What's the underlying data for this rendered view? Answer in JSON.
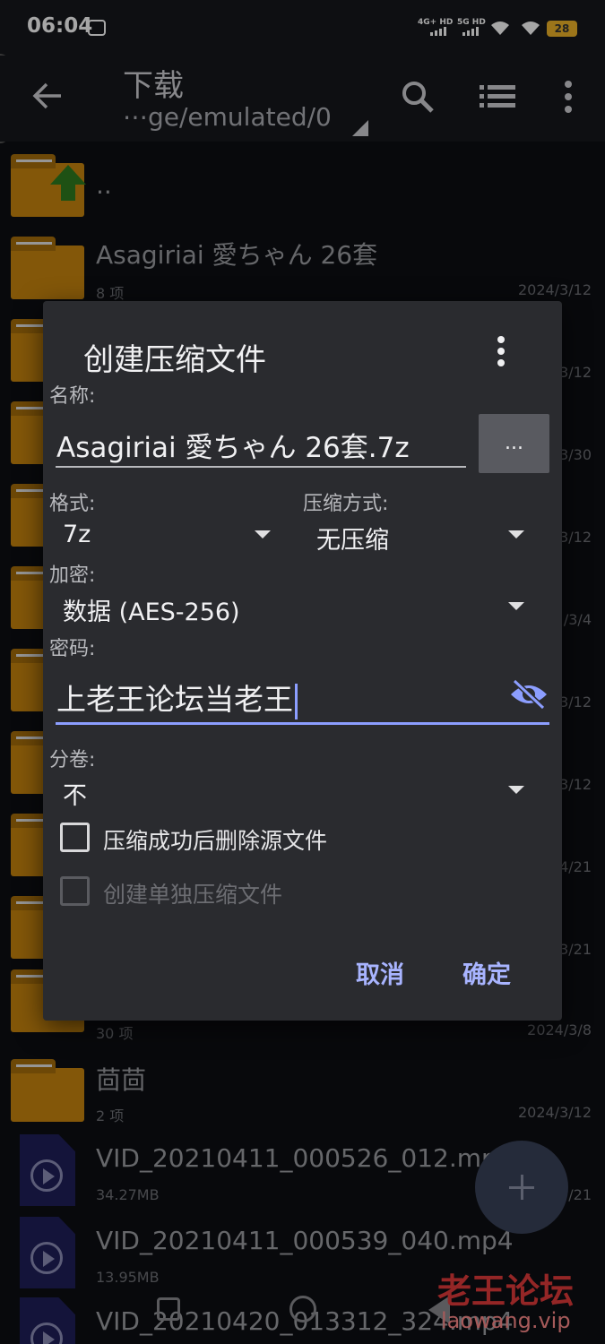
{
  "status": {
    "time": "06:04",
    "sim1": "4G+ HD",
    "sim2": "5G HD",
    "battery": "28"
  },
  "appbar": {
    "title": "下载",
    "path": "⋯ge/emulated/0"
  },
  "files": [
    {
      "name": "..",
      "sub": "",
      "date": "",
      "kind": "up"
    },
    {
      "name": "Asagiriai 愛ちゃん  26套",
      "sub": "8 项",
      "date": "2024/3/12",
      "kind": "folder"
    },
    {
      "name": "",
      "sub": "",
      "date": "3/12",
      "kind": "folder"
    },
    {
      "name": "",
      "sub": "",
      "date": "3/30",
      "kind": "folder"
    },
    {
      "name": "",
      "sub": "",
      "date": "3/12",
      "kind": "folder"
    },
    {
      "name": "",
      "sub": "",
      "date": "/3/4",
      "kind": "folder"
    },
    {
      "name": "",
      "sub": "",
      "date": "3/12",
      "kind": "folder"
    },
    {
      "name": "",
      "sub": "",
      "date": "3/12",
      "kind": "folder"
    },
    {
      "name": "",
      "sub": "",
      "date": "4/21",
      "kind": "folder"
    },
    {
      "name": "",
      "sub": "",
      "date": "3/21",
      "kind": "folder"
    },
    {
      "name": "",
      "sub": "30 项",
      "date": "2024/3/8",
      "kind": "folder"
    },
    {
      "name": "茴茴",
      "sub": "2 项",
      "date": "2024/3/12",
      "kind": "folder"
    },
    {
      "name": "VID_20210411_000526_012.mp4",
      "sub": "34.27MB",
      "date": "/21",
      "kind": "video"
    },
    {
      "name": "VID_20210411_000539_040.mp4",
      "sub": "13.95MB",
      "date": "",
      "kind": "video"
    },
    {
      "name": "VID_20210420_013312_324.mp4",
      "sub": "",
      "date": "",
      "kind": "video"
    }
  ],
  "dialog": {
    "title": "创建压缩文件",
    "name_label": "名称:",
    "name_value": "Asagiriai 愛ちゃん  26套.7z",
    "browse_label": "...",
    "format_label": "格式:",
    "format_value": "7z",
    "method_label": "压缩方式:",
    "method_value": "无压缩",
    "encrypt_label": "加密:",
    "encrypt_value": "数据 (AES-256)",
    "password_label": "密码:",
    "password_value": "上老王论坛当老王",
    "split_label": "分卷:",
    "split_value": "不",
    "delete_source_label": "压缩成功后删除源文件",
    "delete_source_checked": false,
    "separate_label": "创建单独压缩文件",
    "separate_checked": false,
    "cancel_label": "取消",
    "ok_label": "确定"
  },
  "watermark": {
    "title": "老王论坛",
    "url": "laowang.vip"
  },
  "colors": {
    "accent": "#a8b4ff",
    "folder": "#c9860f",
    "dialog_bg": "#2a2b2f"
  }
}
